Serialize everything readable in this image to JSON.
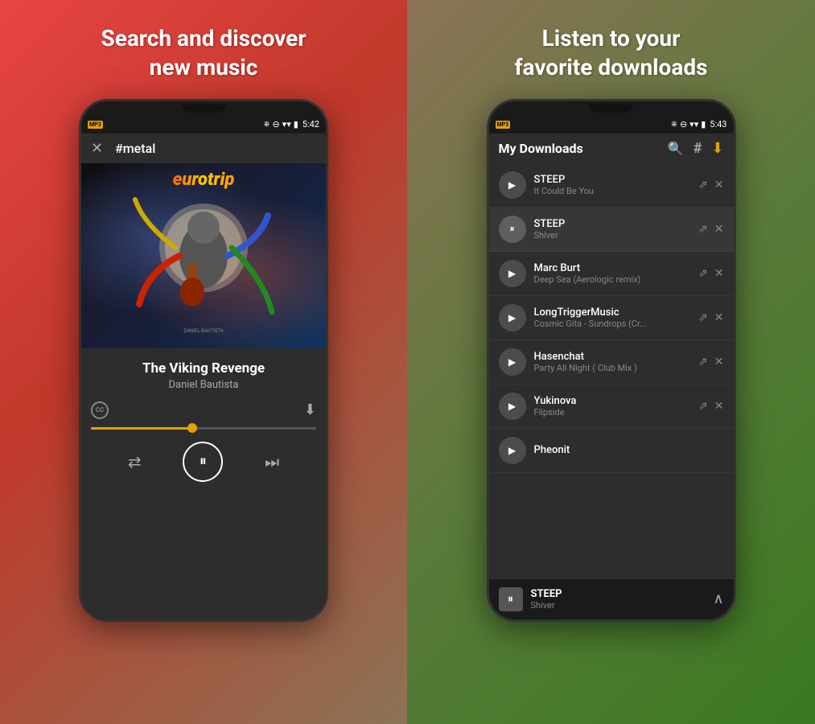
{
  "left": {
    "headline": "Search and discover\nnew music",
    "phone": {
      "status_time": "5:42",
      "screen_title": "#metal",
      "song_title": "The Viking Revenge",
      "song_artist": "Daniel Bautista",
      "album_text": "eurotrip",
      "progress_percent": 45
    }
  },
  "right": {
    "headline": "Listen to your\nfavorite downloads",
    "phone": {
      "status_time": "5:43",
      "screen_title": "My Downloads",
      "tracks": [
        {
          "artist": "STEEP",
          "title": "It Could Be You",
          "playing": false
        },
        {
          "artist": "STEEP",
          "title": "Shiver",
          "playing": true
        },
        {
          "artist": "Marc Burt",
          "title": "Deep Sea (Aerologic remix)",
          "playing": false
        },
        {
          "artist": "LongTriggerMusic",
          "title": "Cosmic Gita - Sundrops (Cr...",
          "playing": false
        },
        {
          "artist": "Hasenchat",
          "title": "Party All Night ( Club Mix )",
          "playing": false
        },
        {
          "artist": "Yukinova",
          "title": "Flipside",
          "playing": false
        },
        {
          "artist": "Pheonit",
          "title": "",
          "playing": false
        }
      ],
      "now_playing_artist": "STEEP",
      "now_playing_title": "Shiver"
    }
  },
  "icons": {
    "play": "▶",
    "pause": "⏸",
    "pause_small": "⏸",
    "shuffle": "⇄",
    "next": "⏭",
    "search": "🔍",
    "hashtag": "#",
    "download": "⬇",
    "share": "⇗",
    "close": "✕",
    "expand": "∧",
    "cc": "CC",
    "bluetooth": "B",
    "wifi": "W",
    "battery": "▮"
  }
}
